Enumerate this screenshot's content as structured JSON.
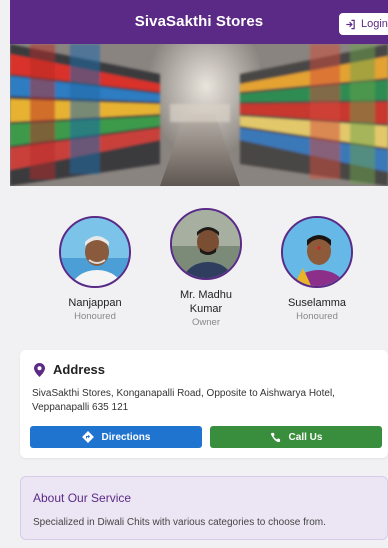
{
  "header": {
    "title": "SivaSakthi Stores",
    "login_label": "Login"
  },
  "profiles": [
    {
      "name": "Nanjappan",
      "role": "Honoured"
    },
    {
      "name": "Mr. Madhu Kumar",
      "role": "Owner"
    },
    {
      "name": "Suselamma",
      "role": "Honoured"
    }
  ],
  "address": {
    "title": "Address",
    "text": "SivaSakthi Stores, Konganapalli Road, Opposite to Aishwarya Hotel, Veppanapalli 635 121",
    "directions_label": "Directions",
    "call_label": "Call Us"
  },
  "service": {
    "title": "About Our Service",
    "text": "Specialized in Diwali Chits with various categories to choose from."
  },
  "colors": {
    "brand": "#5b2a86",
    "directions": "#1f74d0",
    "call": "#388e3c"
  }
}
